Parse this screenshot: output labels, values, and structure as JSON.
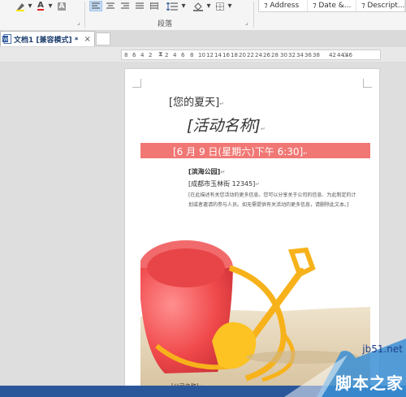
{
  "ribbon": {
    "paragraph_group_label": "段落",
    "styles": [
      "Address",
      "Date &...",
      "Descript..."
    ],
    "font_color_letter": "A"
  },
  "document_tab": {
    "title": "文档1 [兼容模式] *",
    "close": "×"
  },
  "ruler": {
    "ticks": [
      "8",
      "6",
      "4",
      "2",
      "2",
      "4",
      "6",
      "8",
      "10",
      "12",
      "14",
      "16",
      "18",
      "20",
      "22",
      "24",
      "26",
      "28",
      "30",
      "32",
      "34",
      "36",
      "38",
      "42",
      "44",
      "46"
    ]
  },
  "page": {
    "summer_heading": "[您的夏天]",
    "event_name": "[活动名称]",
    "date_line": "[6 月 9 日(星期六)下午 6:30]",
    "venue": "[滨海公园]",
    "address": "[成都市玉林街 12345]",
    "desc_line1": "[在此描述有关您活动的更多信息。您可以分享关于公司的信息、为此制定的计",
    "desc_line2": "划或者邀请的参与人员。如无需提供有关活动的更多信息，请删除此文本。]",
    "footer_placeholder": "[公司名称]"
  },
  "watermark": {
    "url": "jb51.net",
    "site_name": "脚本之家"
  },
  "colors": {
    "band": "#f07774",
    "accent": "#2a579a"
  }
}
